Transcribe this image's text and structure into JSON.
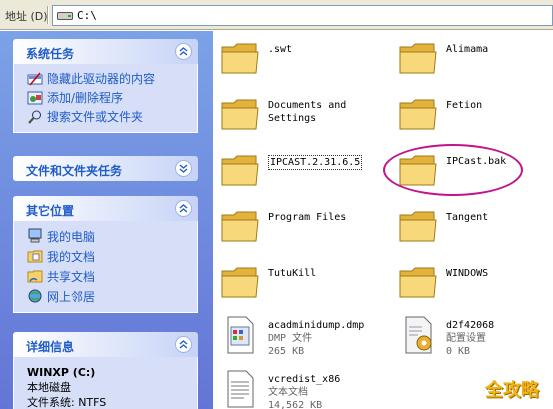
{
  "address_bar": {
    "label": "地址 (D)",
    "path": "C:\\"
  },
  "left_pane": {
    "system_tasks": {
      "title": "系统任务",
      "items": [
        {
          "label": "隐藏此驱动器的内容",
          "icon": "hide-drive-icon"
        },
        {
          "label": "添加/删除程序",
          "icon": "add-remove-programs-icon"
        },
        {
          "label": "搜索文件或文件夹",
          "icon": "search-icon"
        }
      ]
    },
    "file_folder_tasks": {
      "title": "文件和文件夹任务"
    },
    "other_places": {
      "title": "其它位置",
      "items": [
        {
          "label": "我的电脑",
          "icon": "my-computer-icon"
        },
        {
          "label": "我的文档",
          "icon": "my-documents-icon"
        },
        {
          "label": "共享文档",
          "icon": "shared-documents-icon"
        },
        {
          "label": "网上邻居",
          "icon": "network-places-icon"
        }
      ]
    },
    "details": {
      "title": "详细信息",
      "drive_name": "WINXP (C:)",
      "drive_type": "本地磁盘",
      "fs_label": "文件系统: NTFS"
    }
  },
  "files": [
    {
      "name": ".swt",
      "type": "folder"
    },
    {
      "name": "Alimama",
      "type": "folder"
    },
    {
      "name": "Documents and Settings",
      "type": "folder"
    },
    {
      "name": "Fetion",
      "type": "folder"
    },
    {
      "name": "IPCAST.2.31.6.5",
      "type": "folder"
    },
    {
      "name": "IPCast.bak",
      "type": "folder",
      "highlighted": true
    },
    {
      "name": "Program Files",
      "type": "folder"
    },
    {
      "name": "Tangent",
      "type": "folder"
    },
    {
      "name": "TutuKill",
      "type": "folder"
    },
    {
      "name": "WINDOWS",
      "type": "folder"
    },
    {
      "name": "acadminidump.dmp",
      "type": "file",
      "kind": "DMP 文件",
      "size": "265 KB"
    },
    {
      "name": "d2f42068",
      "type": "file",
      "kind": "配置设置",
      "size": "0 KB"
    },
    {
      "name": "vcredist_x86",
      "type": "file",
      "kind": "文本文档",
      "size": "14,562 KB"
    }
  ],
  "watermark": "全攻略",
  "colors": {
    "sidebar": "#6375d6",
    "panel_title": "#215dc6",
    "folder": "#f7d26b",
    "highlight_circle": "#c0148c"
  }
}
